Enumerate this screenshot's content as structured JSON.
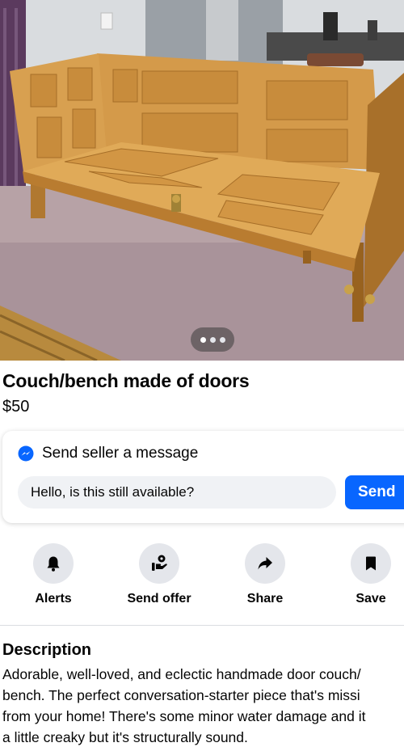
{
  "listing": {
    "title": "Couch/bench made of doors",
    "price": "$50",
    "photo_pager": {
      "count": 3,
      "active_index": 0
    }
  },
  "message": {
    "heading": "Send seller a message",
    "input_value": "Hello, is this still available?",
    "send_label": "Send",
    "icon": "messenger-icon",
    "accent_color": "#0866ff"
  },
  "actions": [
    {
      "label": "Alerts",
      "icon": "bell-icon"
    },
    {
      "label": "Send offer",
      "icon": "send-offer-icon"
    },
    {
      "label": "Share",
      "icon": "share-icon"
    },
    {
      "label": "Save",
      "icon": "bookmark-icon"
    }
  ],
  "description": {
    "heading": "Description",
    "lines": [
      "Adorable, well-loved, and eclectic handmade door couch/",
      "bench. The perfect conversation-starter piece that's missi",
      "from your home! There's some minor water damage and it",
      "a little creaky but it's structurally sound."
    ]
  }
}
